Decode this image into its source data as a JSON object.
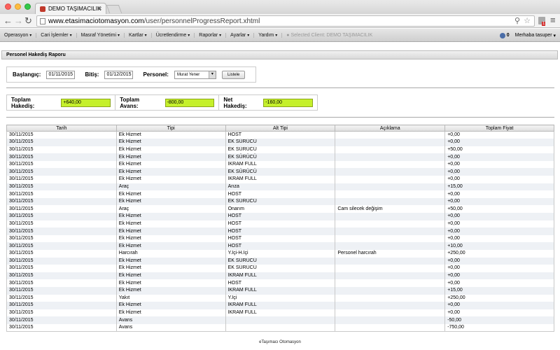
{
  "browser": {
    "tab_title": "DEMO TAŞIMACILIK",
    "url_host": "www.etasimaciotomasyon.com",
    "url_path": "/user/personnelProgressReport.xhtml",
    "ext_badge": "1"
  },
  "menu": {
    "items": [
      {
        "label": "Operasyon"
      },
      {
        "label": "Cari İşlemler"
      },
      {
        "label": "Masraf Yönetimi"
      },
      {
        "label": "Kartlar"
      },
      {
        "label": "Ücretlendirme"
      },
      {
        "label": "Raporlar"
      },
      {
        "label": "Ayarlar"
      },
      {
        "label": "Yardım"
      }
    ],
    "selected_client": "● Selected Client: DEMO TAŞIMACILIK",
    "notification_count": "0",
    "user_greeting": "Merhaba tasuper"
  },
  "panel": {
    "title": "Personel Hakediş Raporu"
  },
  "filter": {
    "start_label": "Başlangıç:",
    "start_value": "01/11/2015",
    "end_label": "Bitiş:",
    "end_value": "01/12/2015",
    "personnel_label": "Personel:",
    "personnel_value": "Murat Yener",
    "list_button": "Listele"
  },
  "totals": {
    "earnings_label": "Toplam Hakediş:",
    "earnings_value": "+640,00",
    "advance_label": "Toplam Avans:",
    "advance_value": "-800,00",
    "net_label": "Net Hakediş:",
    "net_value": "-160,00"
  },
  "table": {
    "headers": [
      "Tarih",
      "Tipi",
      "Alt Tipi",
      "Açıklama",
      "Toplam Fiyat"
    ],
    "rows": [
      [
        "30/11/2015",
        "Ek Hizmet",
        "HOST",
        "",
        "+0,00"
      ],
      [
        "30/11/2015",
        "Ek Hizmet",
        "EK SÜRÜCÜ",
        "",
        "+0,00"
      ],
      [
        "30/11/2015",
        "Ek Hizmet",
        "EK SÜRÜCÜ",
        "",
        "+50,00"
      ],
      [
        "30/11/2015",
        "Ek Hizmet",
        "EK SÜRÜCÜ",
        "",
        "+0,00"
      ],
      [
        "30/11/2015",
        "Ek Hizmet",
        "İKRAM FULL",
        "",
        "+0,00"
      ],
      [
        "30/11/2015",
        "Ek Hizmet",
        "EK SÜRÜCÜ",
        "",
        "+0,00"
      ],
      [
        "30/11/2015",
        "Ek Hizmet",
        "İKRAM FULL",
        "",
        "+0,00"
      ],
      [
        "30/11/2015",
        "Araç",
        "Arıza",
        "",
        "+15,00"
      ],
      [
        "30/11/2015",
        "Ek Hizmet",
        "HOST",
        "",
        "+0,00"
      ],
      [
        "30/11/2015",
        "Ek Hizmet",
        "EK SÜRÜCÜ",
        "",
        "+0,00"
      ],
      [
        "30/11/2015",
        "Araç",
        "Onarım",
        "Cam silecek değişim",
        "+50,00"
      ],
      [
        "30/11/2015",
        "Ek Hizmet",
        "HOST",
        "",
        "+0,00"
      ],
      [
        "30/11/2015",
        "Ek Hizmet",
        "HOST",
        "",
        "+0,00"
      ],
      [
        "30/11/2015",
        "Ek Hizmet",
        "HOST",
        "",
        "+0,00"
      ],
      [
        "30/11/2015",
        "Ek Hizmet",
        "HOST",
        "",
        "+0,00"
      ],
      [
        "30/11/2015",
        "Ek Hizmet",
        "HOST",
        "",
        "+10,00"
      ],
      [
        "30/11/2015",
        "Harcırah",
        "Y.İçi-H.İçi",
        "Personel harcırah",
        "+250,00"
      ],
      [
        "30/11/2015",
        "Ek Hizmet",
        "EK SÜRÜCÜ",
        "",
        "+0,00"
      ],
      [
        "30/11/2015",
        "Ek Hizmet",
        "EK SÜRÜCÜ",
        "",
        "+0,00"
      ],
      [
        "30/11/2015",
        "Ek Hizmet",
        "İKRAM FULL",
        "",
        "+0,00"
      ],
      [
        "30/11/2015",
        "Ek Hizmet",
        "HOST",
        "",
        "+0,00"
      ],
      [
        "30/11/2015",
        "Ek Hizmet",
        "İKRAM FULL",
        "",
        "+15,00"
      ],
      [
        "30/11/2015",
        "Yakıt",
        "Y.İçi",
        "",
        "+250,00"
      ],
      [
        "30/11/2015",
        "Ek Hizmet",
        "İKRAM FULL",
        "",
        "+0,00"
      ],
      [
        "30/11/2015",
        "Ek Hizmet",
        "İKRAM FULL",
        "",
        "+0,00"
      ],
      [
        "30/11/2015",
        "Avans",
        "",
        "",
        "-50,00"
      ],
      [
        "30/11/2015",
        "Avans",
        "",
        "",
        "-750,00"
      ]
    ]
  },
  "footer": {
    "text": "eTaşımacı Otomasyon"
  }
}
